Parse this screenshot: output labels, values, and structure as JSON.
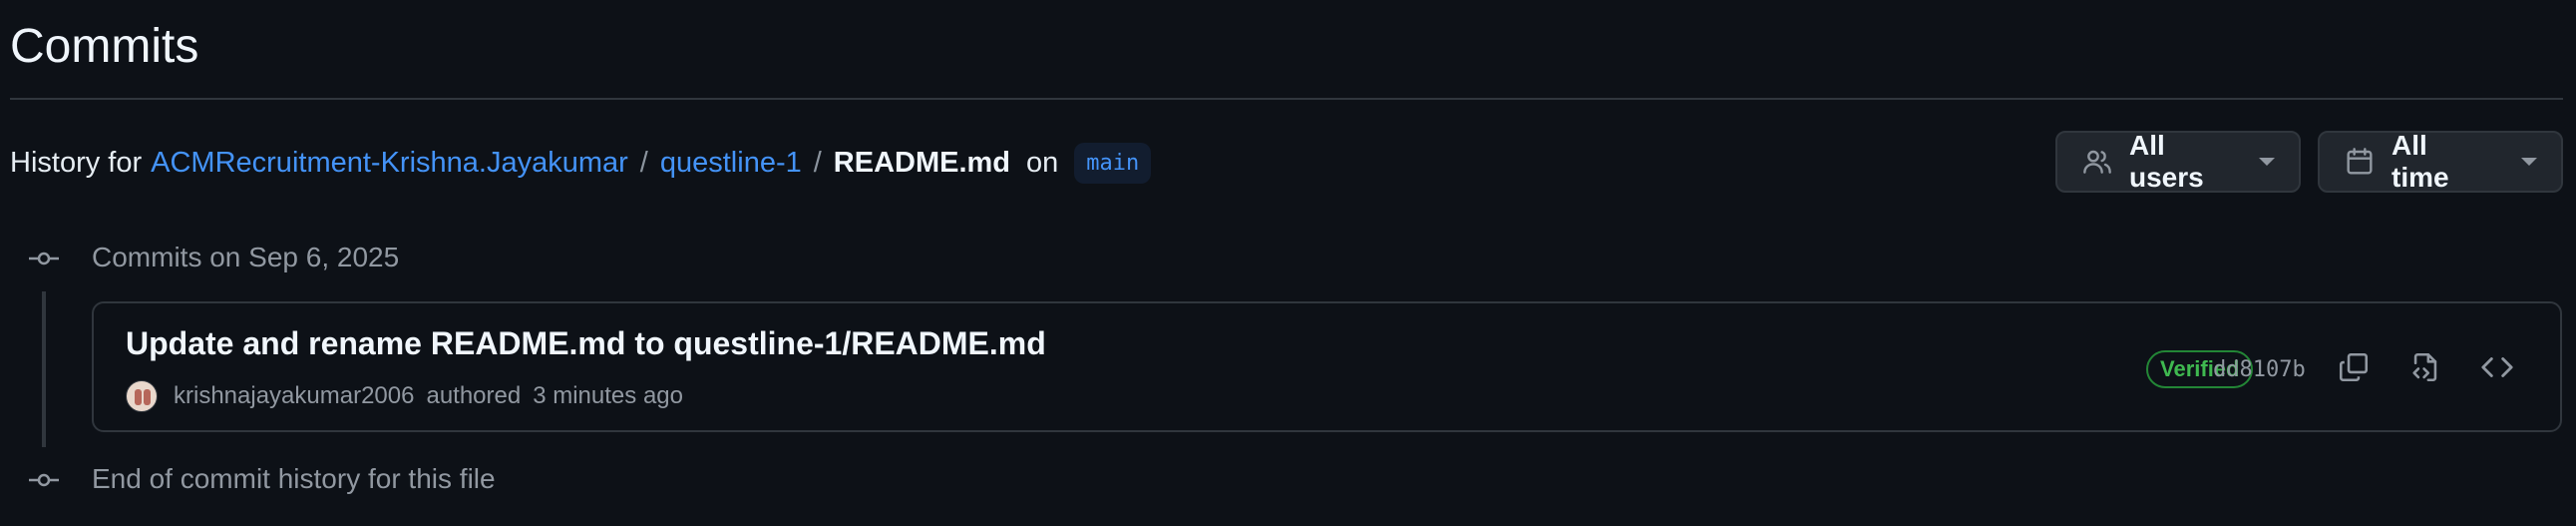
{
  "page": {
    "title": "Commits"
  },
  "history": {
    "prefix": "History for",
    "repo_owner": "ACMRecruitment-Krishna.Jayakumar",
    "separator": "/",
    "folder": "questline-1",
    "file": "README.md",
    "on_label": "on",
    "branch": "main"
  },
  "filters": {
    "users_label": "All users",
    "users_icon": "people-icon",
    "time_label": "All time",
    "time_icon": "calendar-icon"
  },
  "timeline": {
    "group_heading": "Commits on Sep 6, 2025",
    "end_label": "End of commit history for this file"
  },
  "commits": [
    {
      "message": "Update and rename README.md to questline-1/README.md",
      "author": "krishnajayakumar2006",
      "action": "authored",
      "time": "3 minutes ago",
      "badge": "Verified",
      "sha": "dd8107b"
    }
  ],
  "colors": {
    "background": "#0d1117",
    "link": "#4493f8",
    "verified": "#3fb950",
    "border": "#30363d"
  }
}
